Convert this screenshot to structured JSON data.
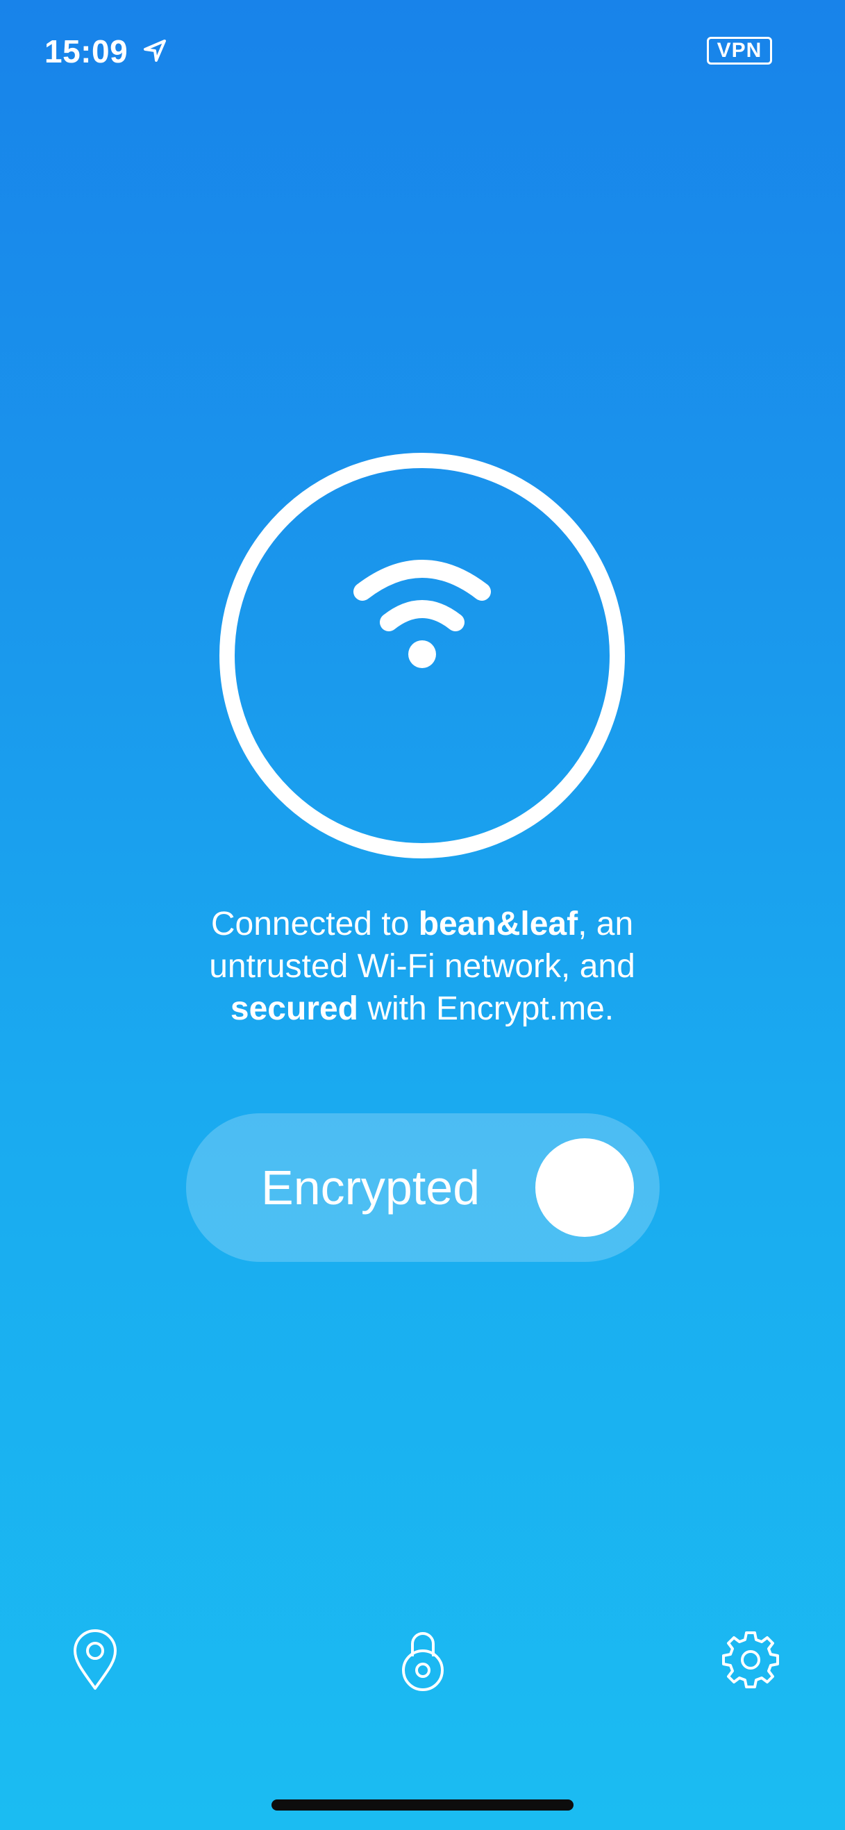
{
  "status_bar": {
    "time": "15:09",
    "vpn_badge": "VPN"
  },
  "connection": {
    "prefix": "Connected to ",
    "network_name": "bean&leaf",
    "middle": ", an untrusted Wi-Fi network, and ",
    "secured_word": "secured",
    "suffix": " with Encrypt.me."
  },
  "toggle": {
    "label": "Encrypted",
    "state": "on"
  },
  "tab_bar": {
    "items": [
      {
        "icon": "location-pin-icon"
      },
      {
        "icon": "lock-icon"
      },
      {
        "icon": "gear-icon"
      }
    ]
  },
  "colors": {
    "background_top": "#1883ea",
    "background_bottom": "#1bbcf2",
    "foreground": "#ffffff"
  }
}
